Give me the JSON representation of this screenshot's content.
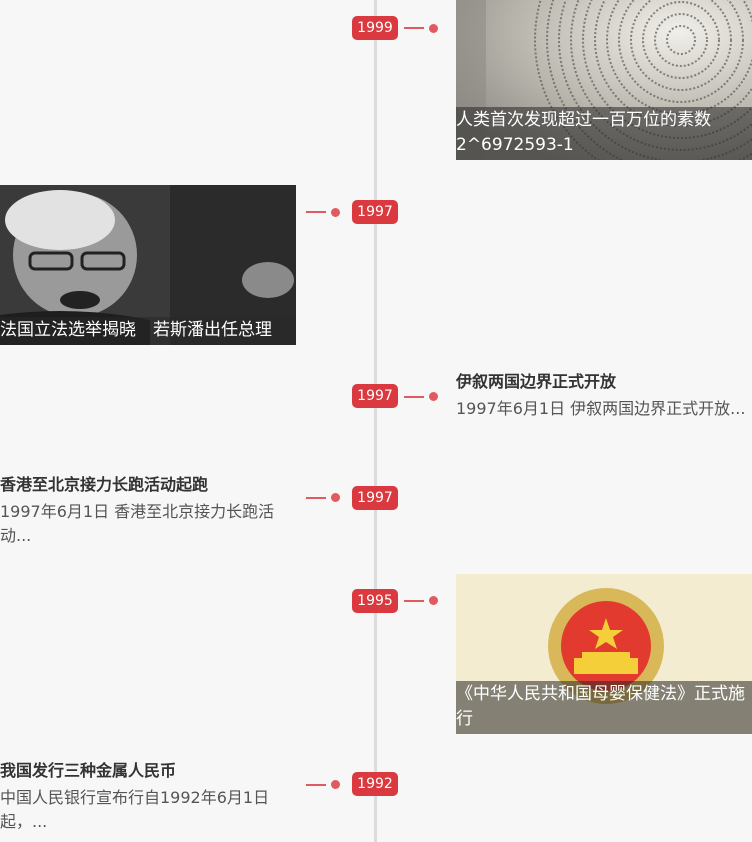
{
  "events": [
    {
      "year": "1999",
      "title": "人类首次发现超过一百万位的素数2^6972593-1",
      "image": "prime-number-spiral-photo"
    },
    {
      "year": "1997",
      "title": "法国立法选举揭晓　若斯潘出任总理",
      "image": "jospin-portrait-photo"
    },
    {
      "year": "1997",
      "title": "伊叙两国边界正式开放",
      "desc": "1997年6月1日 伊叙两国边界正式开放..."
    },
    {
      "year": "1997",
      "title": "香港至北京接力长跑活动起跑",
      "desc": "1997年6月1日 香港至北京接力长跑活动..."
    },
    {
      "year": "1995",
      "title": "《中华人民共和国母婴保健法》正式施行",
      "image": "national-emblem-photo"
    },
    {
      "year": "1992",
      "title": "我国发行三种金属人民币",
      "desc": "中国人民银行宣布行自1992年6月1日起，..."
    }
  ],
  "colors": {
    "badge": "#d9393f",
    "axis": "#dcdcdc",
    "background": "#f7f7f7"
  }
}
